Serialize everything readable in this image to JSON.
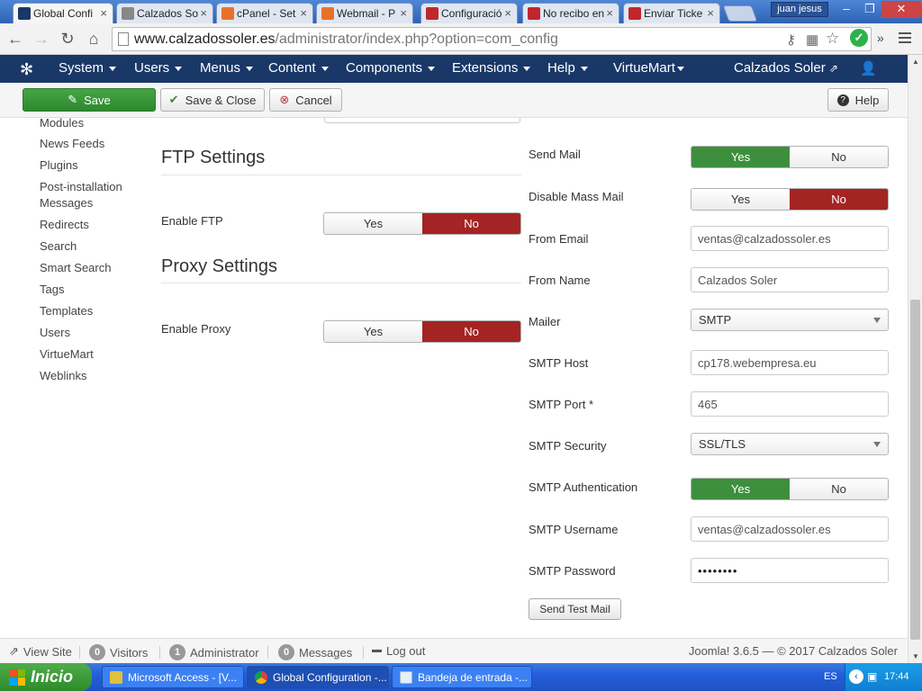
{
  "browser": {
    "tabs": [
      {
        "label": "Global Confi",
        "favicon_color": "#1a3867",
        "active": true
      },
      {
        "label": "Calzados So",
        "favicon_color": "#555555",
        "active": false
      },
      {
        "label": "cPanel - Set",
        "favicon_color": "#e8712a",
        "active": false
      },
      {
        "label": "Webmail - P",
        "favicon_color": "#e8712a",
        "active": false
      },
      {
        "label": "Configuració",
        "favicon_color": "#c0272d",
        "active": false
      },
      {
        "label": "No recibo en",
        "favicon_color": "#c0272d",
        "active": false
      },
      {
        "label": "Enviar Ticke",
        "favicon_color": "#c0272d",
        "active": false
      }
    ],
    "close_glyph": "×",
    "window_user": "juan jesus",
    "url_host": "www.calzadossoler.es",
    "url_path": "/administrator/index.php?option=com_config"
  },
  "joomla_nav": {
    "items": [
      "System",
      "Users",
      "Menus",
      "Content",
      "Components",
      "Extensions",
      "Help",
      "VirtueMart"
    ],
    "site_name": "Calzados Soler"
  },
  "toolbar": {
    "save": "Save",
    "save_close": "Save & Close",
    "cancel": "Cancel",
    "help": "Help"
  },
  "sidebar": {
    "items": [
      "Modules",
      "News Feeds",
      "Plugins",
      "Post-installation",
      "Messages",
      "Redirects",
      "Search",
      "Smart Search",
      "Tags",
      "Templates",
      "Users",
      "VirtueMart",
      "Weblinks"
    ]
  },
  "ftp": {
    "title": "FTP Settings",
    "enable_label": "Enable FTP",
    "yes": "Yes",
    "no": "No",
    "value": "No"
  },
  "proxy": {
    "title": "Proxy Settings",
    "enable_label": "Enable Proxy",
    "yes": "Yes",
    "no": "No",
    "value": "No"
  },
  "mail": {
    "send_mail_label": "Send Mail",
    "send_mail_value": "Yes",
    "disable_mass_label": "Disable Mass Mail",
    "disable_mass_value": "No",
    "from_email_label": "From Email",
    "from_email": "ventas@calzadossoler.es",
    "from_name_label": "From Name",
    "from_name": "Calzados Soler",
    "mailer_label": "Mailer",
    "mailer": "SMTP",
    "smtp_host_label": "SMTP Host",
    "smtp_host": "cp178.webempresa.eu",
    "smtp_port_label": "SMTP Port *",
    "smtp_port": "465",
    "smtp_security_label": "SMTP Security",
    "smtp_security": "SSL/TLS",
    "smtp_auth_label": "SMTP Authentication",
    "smtp_auth_value": "Yes",
    "smtp_username_label": "SMTP Username",
    "smtp_username": "ventas@calzadossoler.es",
    "smtp_password_label": "SMTP Password",
    "smtp_password": "••••••••",
    "yes": "Yes",
    "no": "No",
    "send_test": "Send Test Mail"
  },
  "status": {
    "view_site": "View Site",
    "visitors_count": "0",
    "visitors": "Visitors",
    "admin_count": "1",
    "admin": "Administrator",
    "messages_count": "0",
    "messages": "Messages",
    "logout": "Log out",
    "footer": "Joomla! 3.6.5 — © 2017 Calzados Soler"
  },
  "taskbar": {
    "start": "Inicio",
    "items": [
      {
        "label": "Microsoft Access - [V...",
        "icon_color": "#b22222"
      },
      {
        "label": "Global Configuration -...",
        "icon_color": "#e0a020"
      },
      {
        "label": "Bandeja de entrada -...",
        "icon_color": "#3a7bd5"
      }
    ],
    "lang": "ES",
    "clock": "17:44"
  },
  "colors": {
    "joomla_navy": "#1a3867",
    "save_green": "#46a546",
    "toggle_green": "#3d8f3d",
    "toggle_red": "#a42424"
  }
}
